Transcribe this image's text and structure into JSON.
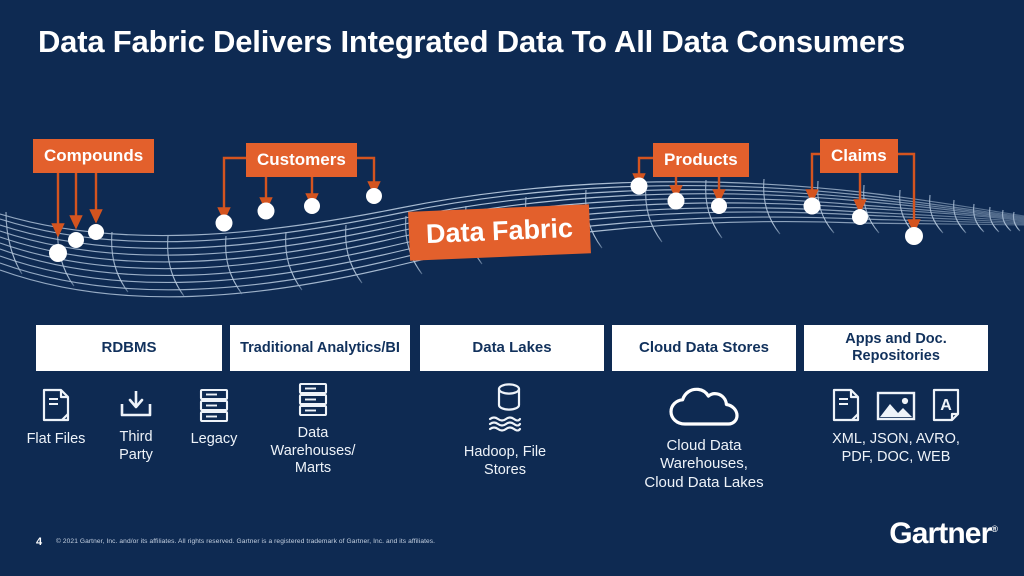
{
  "slide": {
    "title": "Data Fabric Delivers Integrated Data To All Data Consumers",
    "center_tag": "Data Fabric"
  },
  "colors": {
    "background": "#0e2a52",
    "accent_orange": "#e3602c",
    "box_white": "#ffffff",
    "box_text_navy": "#11315c",
    "mesh_line": "#a9bdd4"
  },
  "sources": [
    {
      "label": "Compounds",
      "arrows": 3
    },
    {
      "label": "Customers",
      "arrows": 4
    },
    {
      "label": "Products",
      "arrows": 3
    },
    {
      "label": "Claims",
      "arrows": 3
    }
  ],
  "categories": [
    {
      "title": "RDBMS"
    },
    {
      "title": "Traditional Analytics/BI"
    },
    {
      "title": "Data Lakes"
    },
    {
      "title": "Cloud Data Stores"
    },
    {
      "title": "Apps and Doc. Repositories"
    }
  ],
  "items": [
    {
      "caption": "Flat Files",
      "icons": [
        "document-icon"
      ]
    },
    {
      "caption": "Third Party",
      "icons": [
        "import-download-icon"
      ]
    },
    {
      "caption": "Legacy",
      "icons": [
        "server-rack-icon"
      ]
    },
    {
      "caption": "Data Warehouses/ Marts",
      "icons": [
        "server-rack-icon"
      ]
    },
    {
      "caption": "Hadoop, File Stores",
      "icons": [
        "database-cylinder-icon",
        "water-waves-icon"
      ]
    },
    {
      "caption": "Cloud Data Warehouses, Cloud Data Lakes",
      "icons": [
        "cloud-icon"
      ]
    },
    {
      "caption": "XML, JSON, AVRO, PDF, DOC, WEB",
      "icons": [
        "document-icon",
        "image-icon",
        "text-document-icon"
      ]
    }
  ],
  "footer": {
    "page_number": "4",
    "copyright": "© 2021 Gartner, Inc. and/or its affiliates. All rights reserved. Gartner is a registered trademark of Gartner, Inc. and its affiliates.",
    "logo_text": "Gartner",
    "logo_mark": "®"
  }
}
